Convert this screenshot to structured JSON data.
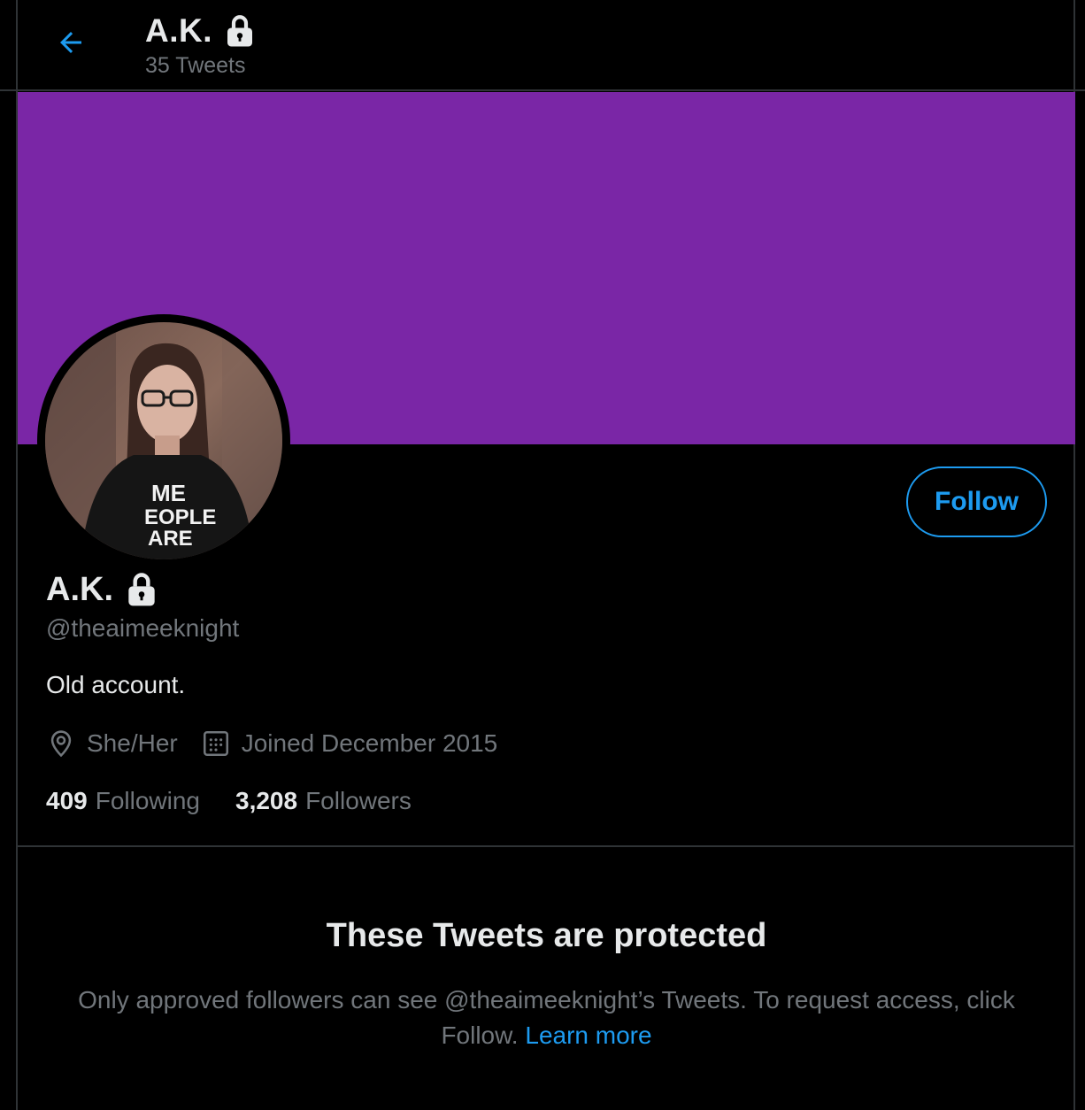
{
  "header": {
    "name": "A.K.",
    "tweet_count": "35 Tweets"
  },
  "profile": {
    "banner_color": "#7a26a6",
    "name": "A.K.",
    "handle": "@theaimeeknight",
    "bio": "Old account.",
    "location": "She/Her",
    "joined": "Joined December 2015",
    "following_count": "409",
    "following_label": "Following",
    "followers_count": "3,208",
    "followers_label": "Followers",
    "follow_button_label": "Follow"
  },
  "protected": {
    "title": "These Tweets are protected",
    "message": "Only approved followers can see @theaimeeknight’s Tweets. To request access, click Follow.",
    "learn_more": "Learn more"
  },
  "colors": {
    "accent": "#1d9bf0",
    "background": "#000000",
    "primary_text": "#e7e9ea",
    "secondary_text": "#71767b",
    "banner": "#7a26a6"
  },
  "icons": {
    "back": "arrow-left-icon",
    "lock": "lock-icon",
    "location": "location-pin-icon",
    "calendar": "calendar-icon"
  }
}
